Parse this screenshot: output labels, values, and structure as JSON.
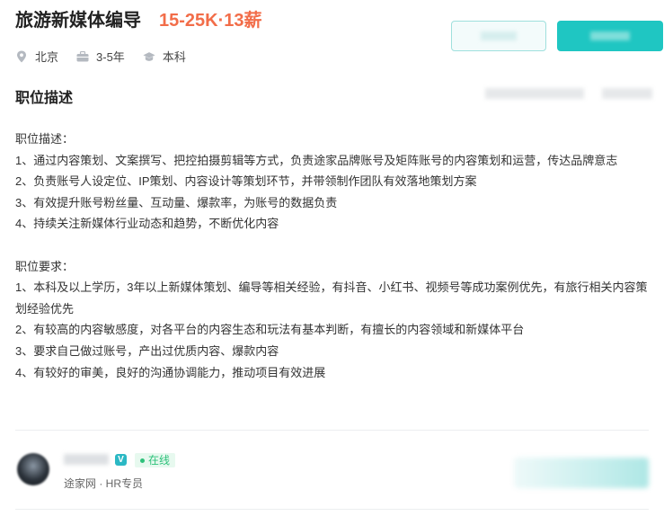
{
  "job": {
    "title": "旅游新媒体编导",
    "salary": "15-25K·13薪",
    "location": "北京",
    "experience": "3-5年",
    "education": "本科"
  },
  "section": {
    "title": "职位描述"
  },
  "description": {
    "duties_title": "职位描述：",
    "duties": [
      "1、通过内容策划、文案撰写、把控拍摄剪辑等方式，负责途家品牌账号及矩阵账号的内容策划和运营，传达品牌意志",
      "2、负责账号人设定位、IP策划、内容设计等策划环节，并带领制作团队有效落地策划方案",
      "3、有效提升账号粉丝量、互动量、爆款率，为账号的数据负责",
      "4、持续关注新媒体行业动态和趋势，不断优化内容"
    ],
    "requirements_title": "职位要求：",
    "requirements": [
      "1、本科及以上学历，3年以上新媒体策划、编导等相关经验，有抖音、小红书、视频号等成功案例优先，有旅行相关内容策划经验优先",
      "2、有较高的内容敏感度，对各平台的内容生态和玩法有基本判断，有擅长的内容领域和新媒体平台",
      "3、要求自己做过账号，产出过优质内容、爆款内容",
      "4、有较好的审美，良好的沟通协调能力，推动项目有效进展"
    ]
  },
  "recruiter": {
    "verified_mark": "V",
    "status": "在线",
    "company_role": "途家网 · HR专员"
  },
  "colors": {
    "salary": "#f26d49",
    "primary_button": "#1fc6c2",
    "online": "#2ec17b",
    "verify_badge": "#2bb8c4"
  },
  "icons": {
    "location": "location-pin-icon",
    "experience": "briefcase-icon",
    "education": "graduation-cap-icon"
  }
}
